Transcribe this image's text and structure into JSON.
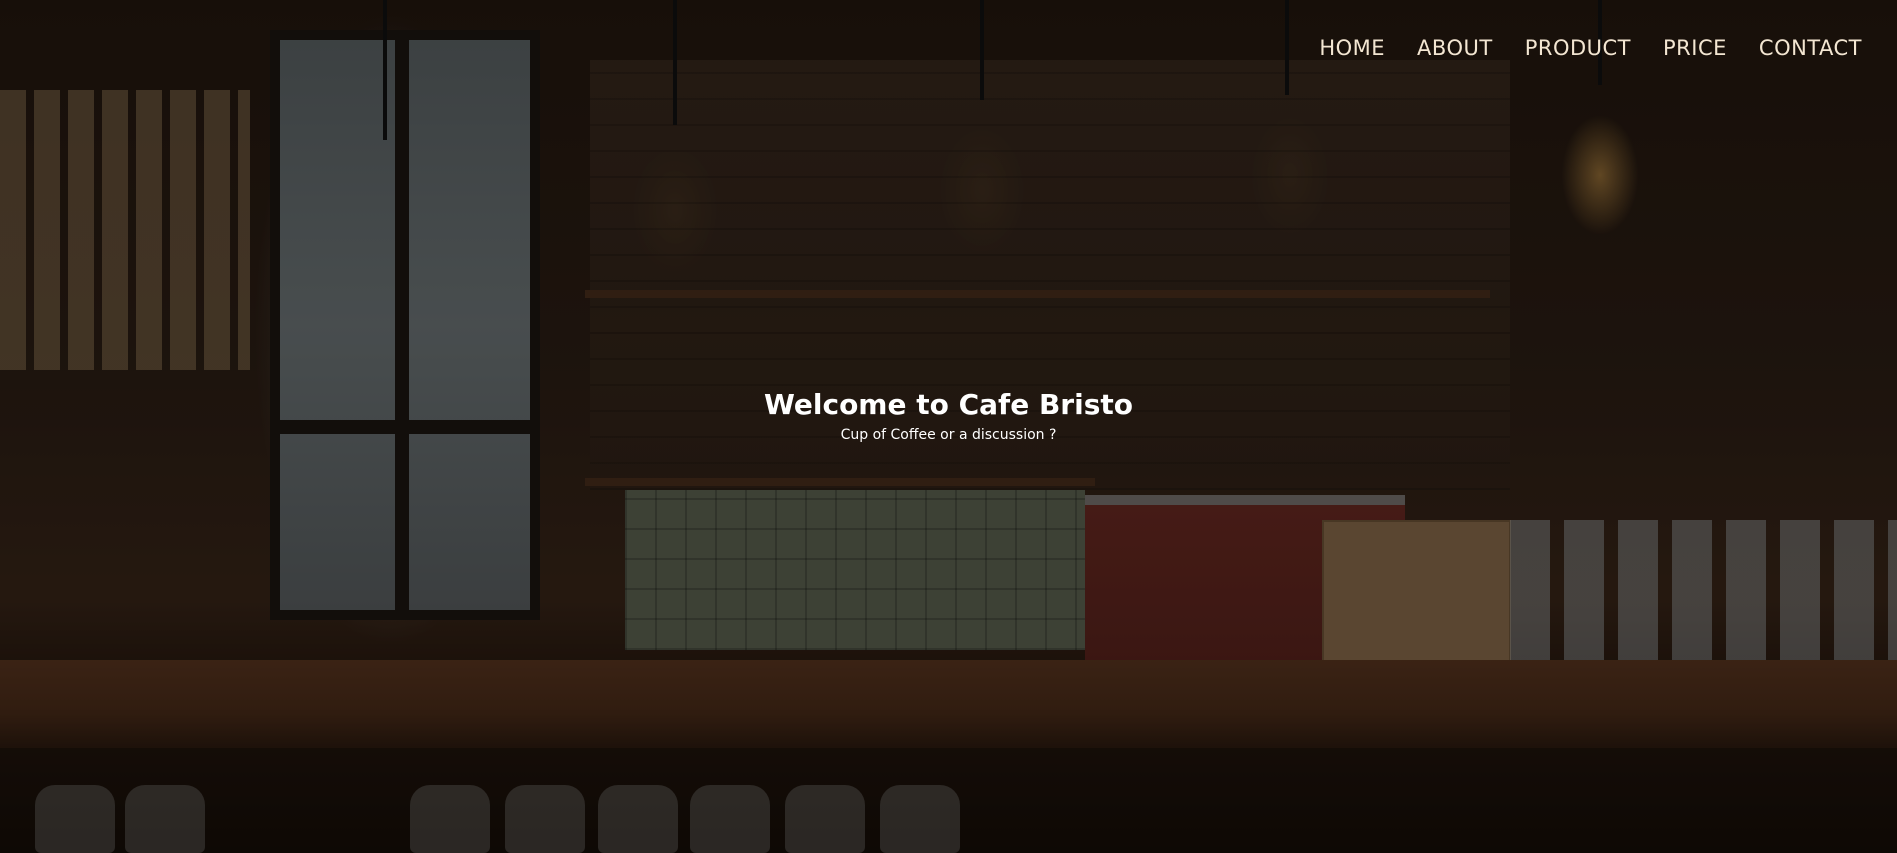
{
  "nav": {
    "items": [
      {
        "label": "HOME"
      },
      {
        "label": "ABOUT"
      },
      {
        "label": "PRODUCT"
      },
      {
        "label": "PRICE"
      },
      {
        "label": "CONTACT"
      }
    ]
  },
  "hero": {
    "title": "Welcome to Cafe Bristo",
    "subtitle": "Cup of Coffee or a discussion ?",
    "background_image": "cafe-interior-photo"
  },
  "colors": {
    "nav_text": "#f3e6d2",
    "hero_text": "#ffffff",
    "overlay": "rgba(0,0,0,0.35)"
  }
}
